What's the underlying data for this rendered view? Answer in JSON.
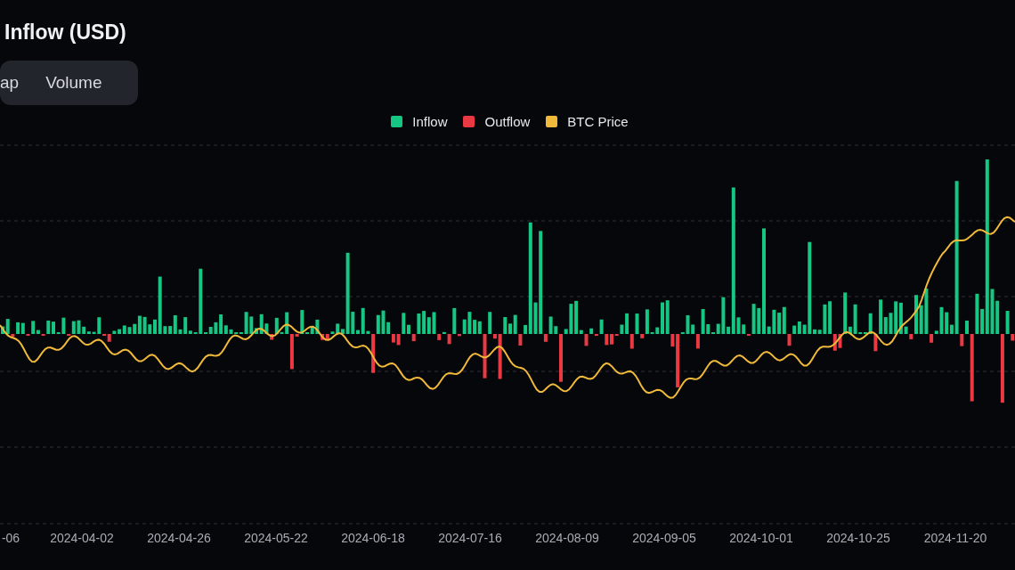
{
  "title": "Inflow (USD)",
  "tabs": [
    {
      "label": "ap",
      "selected": false
    },
    {
      "label": "Volume",
      "selected": false
    }
  ],
  "legend": [
    {
      "label": "Inflow",
      "kind": "inflow",
      "color": "#16c784"
    },
    {
      "label": "Outflow",
      "kind": "outflow",
      "color": "#ea3943"
    },
    {
      "label": "BTC Price",
      "kind": "line",
      "color": "#f0b93a"
    }
  ],
  "x_axis_labels": [
    "-06",
    "2024-04-02",
    "2024-04-26",
    "2024-05-22",
    "2024-06-18",
    "2024-07-16",
    "2024-08-09",
    "2024-09-05",
    "2024-10-01",
    "2024-10-25",
    "2024-11-20"
  ]
}
